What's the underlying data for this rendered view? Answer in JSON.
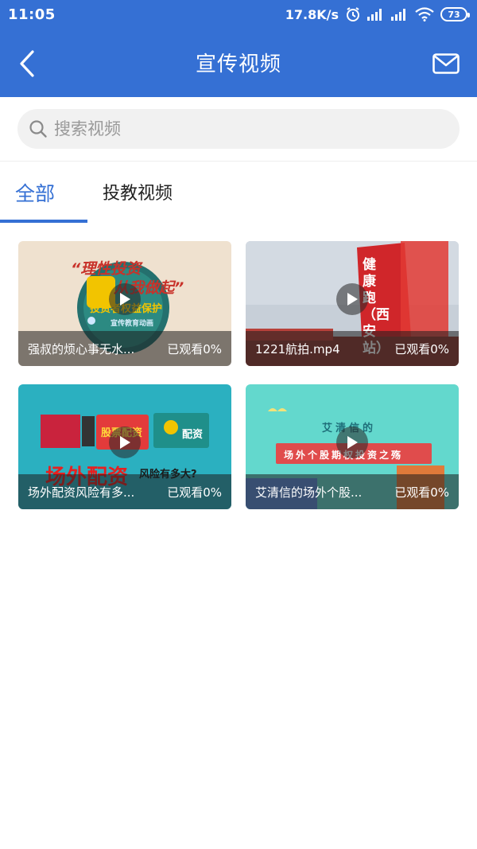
{
  "status_bar": {
    "time": "11:05",
    "network_speed": "17.8K/s",
    "battery": "73"
  },
  "app_bar": {
    "title": "宣传视频",
    "back_icon": "chevron-left-icon",
    "mail_icon": "mail-icon"
  },
  "search": {
    "placeholder": "搜索视频"
  },
  "tabs": [
    {
      "label": "全部",
      "active": true
    },
    {
      "label": "投教视频",
      "active": false
    }
  ],
  "videos": [
    {
      "title": "强叔的烦心事无水...",
      "progress": "已观看0%",
      "thumb_text": [
        "“理性投资",
        "从我做起”",
        "投资者权益保护",
        "宣传教育动画"
      ]
    },
    {
      "title": "1221航拍.mp4",
      "progress": "已观看0%",
      "thumb_text": [
        "健康跑（西安站）"
      ]
    },
    {
      "title": "场外配资风险有多...",
      "progress": "已观看0%",
      "thumb_text": [
        "股票配资",
        "配资",
        "场外配资",
        "风险有多大?"
      ]
    },
    {
      "title": "艾清信的场外个股...",
      "progress": "已观看0%",
      "thumb_text": [
        "艾清信的",
        "场外个股期权投资之殇"
      ]
    }
  ],
  "colors": {
    "primary": "#3570d4",
    "search_bg": "#f1f1f1"
  }
}
